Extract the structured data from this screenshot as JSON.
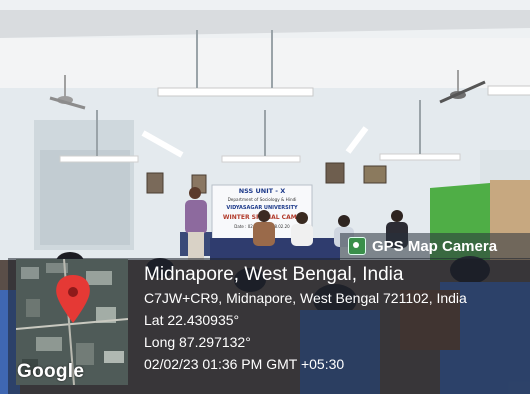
{
  "banner": {
    "line1": "NSS UNIT - X",
    "line2": "Department of Sociology & Hindi",
    "line3": "VIDYASAGAR UNIVERSITY",
    "line4": "WINTER SPECIAL CAMP",
    "line5": "Date : 02.02.20 ... 08.02.20"
  },
  "overlay": {
    "badge_icon": "gps-map-camera-icon",
    "badge_label": "GPS Map Camera",
    "city": "Midnapore, West Bengal, India",
    "address": "C7JW+CR9, Midnapore, West Bengal 721102, India",
    "lat": "Lat 22.430935°",
    "long": "Long 87.297132°",
    "datetime": "02/02/23 01:36 PM GMT +05:30",
    "map_brand": "Google",
    "pin_icon": "map-pin-icon"
  },
  "colors": {
    "wall": "#e9eef2",
    "ceiling": "#f2f4f5",
    "green_wall": "#4fae46",
    "pin": "#e53935"
  }
}
